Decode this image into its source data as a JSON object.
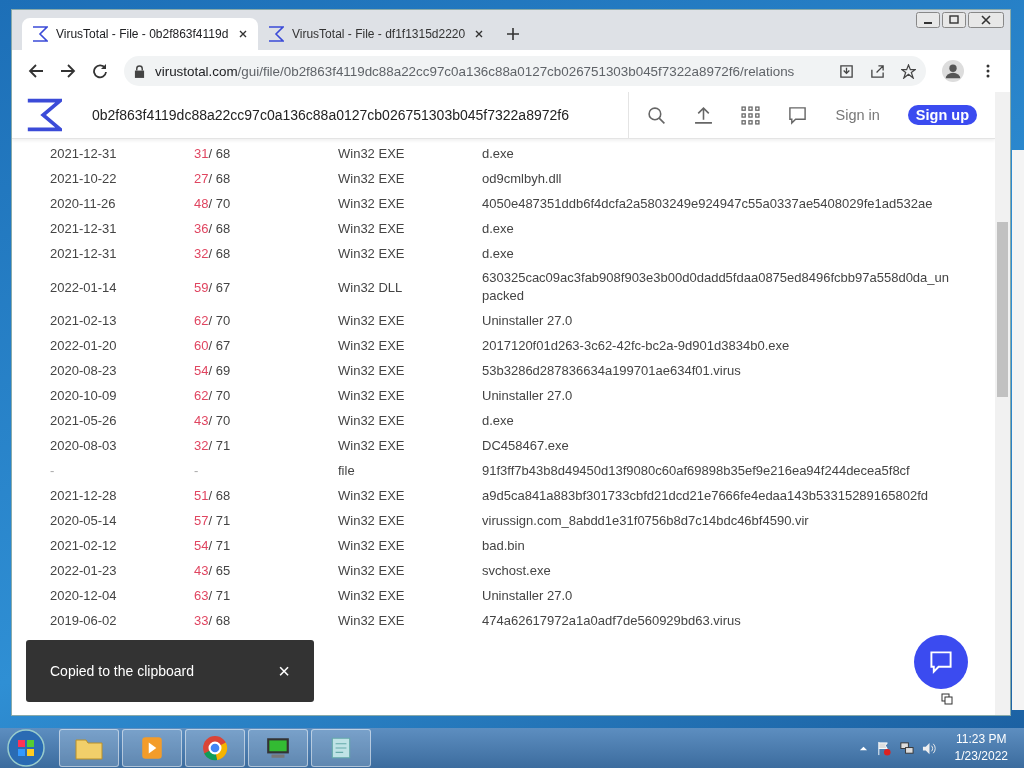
{
  "tabs": [
    {
      "title": "VirusTotal - File - 0b2f863f4119d",
      "selected": true
    },
    {
      "title": "VirusTotal - File - df1f1315d2220",
      "selected": false
    }
  ],
  "address": {
    "host": "virustotal.com",
    "path": "/gui/file/0b2f863f4119dc88a22cc97c0a136c88a0127cb026751303b045f7322a8972f6/relations"
  },
  "search": {
    "value": "0b2f863f4119dc88a22cc97c0a136c88a0127cb026751303b045f7322a8972f6"
  },
  "header_links": {
    "sign_in": "Sign in",
    "sign_up": "Sign up"
  },
  "rows": [
    {
      "date": "2021-12-31",
      "positives": "31",
      "total": "/ 68",
      "type": "Win32 EXE",
      "name": "d.exe"
    },
    {
      "date": "2021-10-22",
      "positives": "27",
      "total": "/ 68",
      "type": "Win32 EXE",
      "name": "od9cmlbyh.dll"
    },
    {
      "date": "2020-11-26",
      "positives": "48",
      "total": "/ 70",
      "type": "Win32 EXE",
      "name": "4050e487351ddb6f4dcfa2a5803249e924947c55a0337ae5408029fe1ad532ae"
    },
    {
      "date": "2021-12-31",
      "positives": "36",
      "total": "/ 68",
      "type": "Win32 EXE",
      "name": "d.exe"
    },
    {
      "date": "2021-12-31",
      "positives": "32",
      "total": "/ 68",
      "type": "Win32 EXE",
      "name": "d.exe"
    },
    {
      "date": "2022-01-14",
      "positives": "59",
      "total": "/ 67",
      "type": "Win32 DLL",
      "name": "630325cac09ac3fab908f903e3b00d0dadd5fdaa0875ed8496fcbb97a558d0da_unpacked"
    },
    {
      "date": "2021-02-13",
      "positives": "62",
      "total": "/ 70",
      "type": "Win32 EXE",
      "name": "Uninstaller 27.0"
    },
    {
      "date": "2022-01-20",
      "positives": "60",
      "total": "/ 67",
      "type": "Win32 EXE",
      "name": "2017120f01d263-3c62-42fc-bc2a-9d901d3834b0.exe"
    },
    {
      "date": "2020-08-23",
      "positives": "54",
      "total": "/ 69",
      "type": "Win32 EXE",
      "name": "53b3286d287836634a199701ae634f01.virus"
    },
    {
      "date": "2020-10-09",
      "positives": "62",
      "total": "/ 70",
      "type": "Win32 EXE",
      "name": "Uninstaller 27.0"
    },
    {
      "date": "2021-05-26",
      "positives": "43",
      "total": "/ 70",
      "type": "Win32 EXE",
      "name": "d.exe"
    },
    {
      "date": "2020-08-03",
      "positives": "32",
      "total": "/ 71",
      "type": "Win32 EXE",
      "name": "DC458467.exe"
    },
    {
      "date": "-",
      "positives": "-",
      "type": "file",
      "name": "91f3ff7b43b8d49450d13f9080c60af69898b35ef9e216ea94f244decea5f8cf"
    },
    {
      "date": "2021-12-28",
      "positives": "51",
      "total": "/ 68",
      "type": "Win32 EXE",
      "name": "a9d5ca841a883bf301733cbfd21dcd21e7666fe4edaa143b53315289165802fd"
    },
    {
      "date": "2020-05-14",
      "positives": "57",
      "total": "/ 71",
      "type": "Win32 EXE",
      "name": "virussign.com_8abdd1e31f0756b8d7c14bdc46bf4590.vir"
    },
    {
      "date": "2021-02-12",
      "positives": "54",
      "total": "/ 71",
      "type": "Win32 EXE",
      "name": "bad.bin"
    },
    {
      "date": "2022-01-23",
      "positives": "43",
      "total": "/ 65",
      "type": "Win32 EXE",
      "name": "svchost.exe"
    },
    {
      "date": "2020-12-04",
      "positives": "63",
      "total": "/ 71",
      "type": "Win32 EXE",
      "name": "Uninstaller 27.0"
    },
    {
      "date": "2019-06-02",
      "positives": "33",
      "total": "/ 68",
      "type": "Win32 EXE",
      "name": "474a62617972a1a0adf7de560929bd63.virus"
    }
  ],
  "toast": {
    "message": "Copied to the clipboard",
    "close": "×"
  },
  "clock": {
    "time": "11:23 PM",
    "date": "1/23/2022"
  }
}
